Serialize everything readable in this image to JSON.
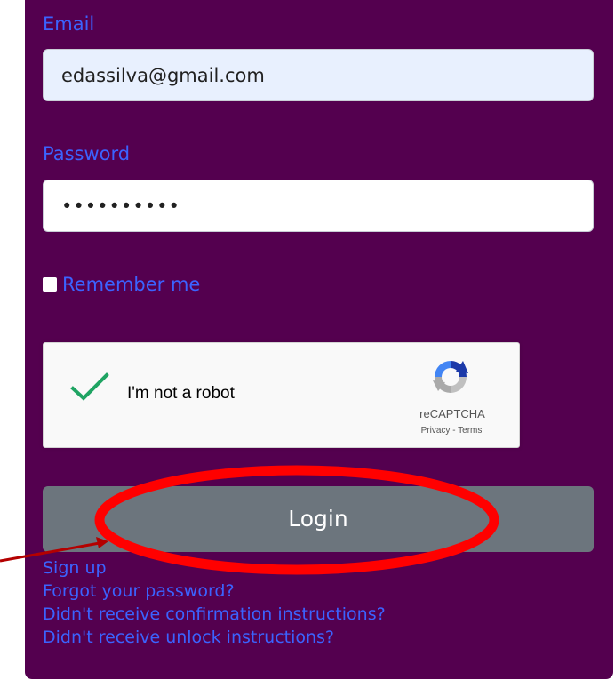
{
  "form": {
    "email_label": "Email",
    "email_value": "edassilva@gmail.com",
    "password_label": "Password",
    "password_value": "••••••••••",
    "remember_label": "Remember me",
    "remember_checked": false,
    "login_label": "Login"
  },
  "recaptcha": {
    "checked": true,
    "label": "I'm not a robot",
    "brand": "reCAPTCHA",
    "privacy": "Privacy",
    "separator": " - ",
    "terms": "Terms"
  },
  "links": [
    "Sign up",
    "Forgot your password?",
    "Didn't receive confirmation instructions?",
    "Didn't receive unlock instructions?"
  ],
  "colors": {
    "panel": "#54004f",
    "label": "#3b63ff",
    "login_button": "#6c757d",
    "annotation": "#ff0000",
    "check": "#1fa463"
  },
  "icons": {
    "checkmark": "check-icon",
    "recaptcha_logo": "recaptcha-logo-icon"
  }
}
